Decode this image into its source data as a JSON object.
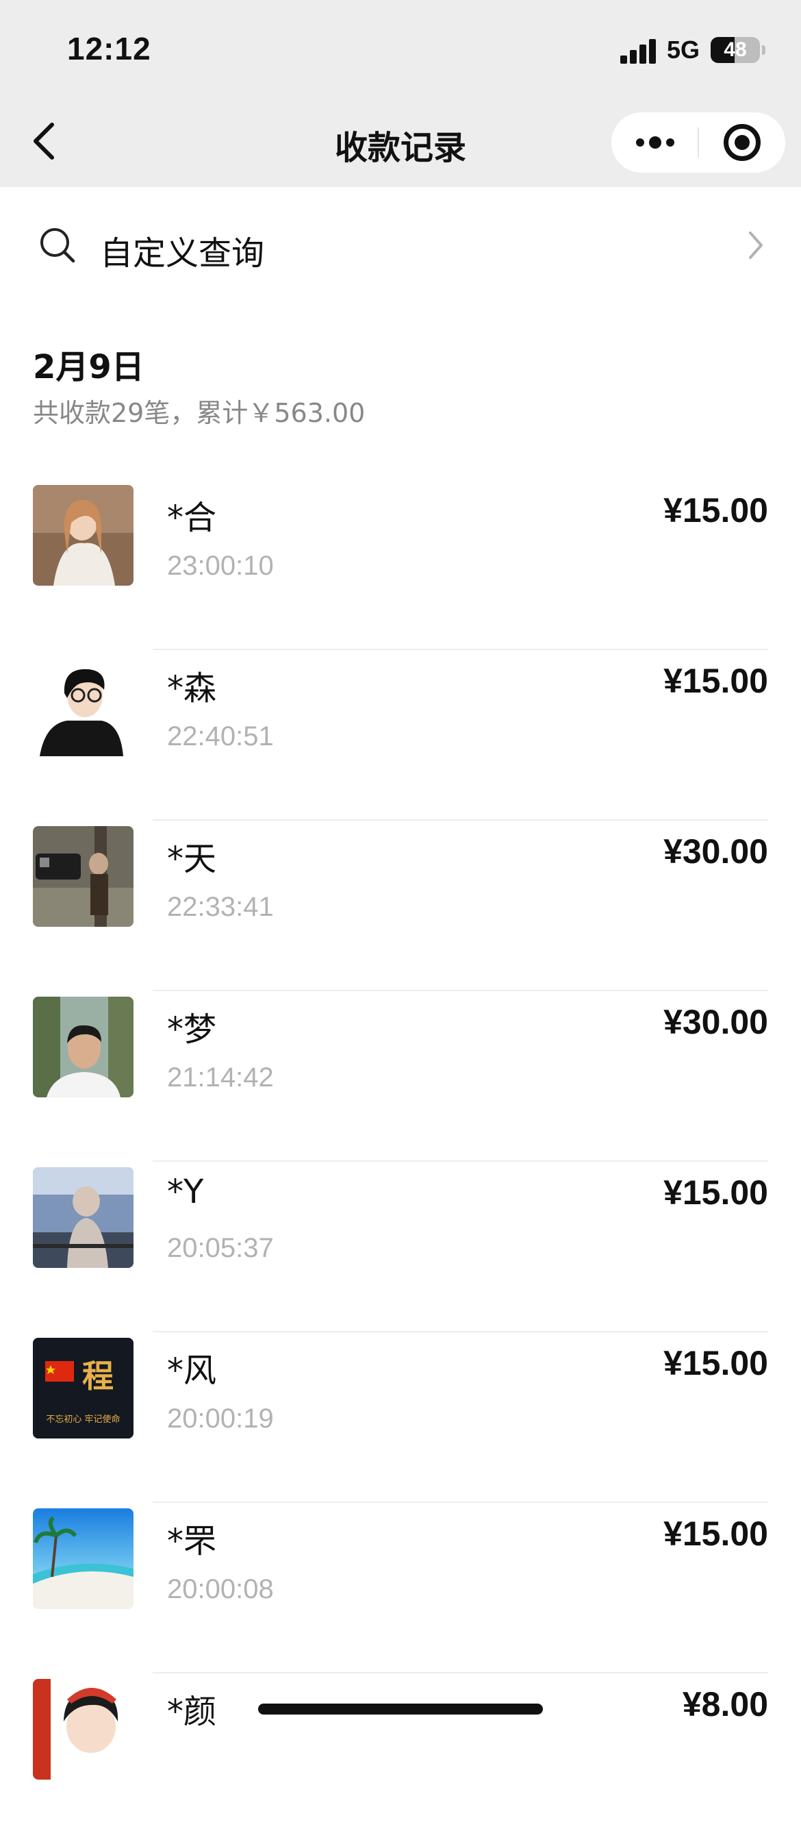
{
  "status_bar": {
    "time": "12:12",
    "network": "5G",
    "battery": "48",
    "battery_level": 0.48
  },
  "nav": {
    "title": "收款记录"
  },
  "search": {
    "label": "自定义查询"
  },
  "group": {
    "date": "2月9日",
    "summary": "共收款29笔，累计￥563.00"
  },
  "records": [
    {
      "name": "*合",
      "time": "23:00:10",
      "amount": "¥15.00"
    },
    {
      "name": "*森",
      "time": "22:40:51",
      "amount": "¥15.00"
    },
    {
      "name": "*天",
      "time": "22:33:41",
      "amount": "¥30.00"
    },
    {
      "name": "*梦",
      "time": "21:14:42",
      "amount": "¥30.00"
    },
    {
      "name": "*Y",
      "time": "20:05:37",
      "amount": "¥15.00"
    },
    {
      "name": "*风",
      "time": "20:00:19",
      "amount": "¥15.00",
      "avatar_text": "程",
      "avatar_subtext": "不忘初心 牢记使命"
    },
    {
      "name": "*罘",
      "time": "20:00:08",
      "amount": "¥15.00"
    },
    {
      "name": "*颜",
      "time": "",
      "amount": "¥8.00"
    }
  ],
  "icons": {
    "back": "chevron-left-icon",
    "more": "more-dots-icon",
    "close": "close-target-icon",
    "search": "search-icon",
    "chevron": "chevron-right-icon"
  }
}
